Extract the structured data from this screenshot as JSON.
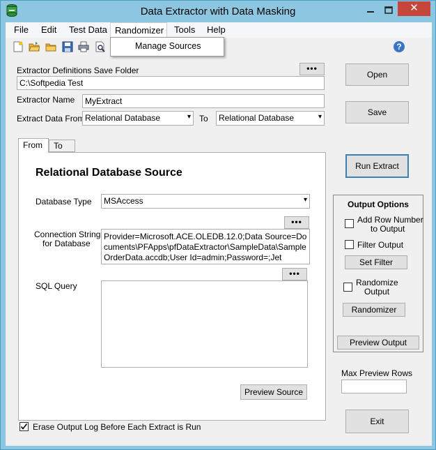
{
  "window": {
    "title": "Data Extractor with Data Masking",
    "close_glyph": "✕",
    "minimize_glyph": "–",
    "maximize_glyph": "☐"
  },
  "menu": {
    "items": [
      "File",
      "Edit",
      "Test Data",
      "Randomizer",
      "Tools",
      "Help"
    ],
    "active": "Randomizer",
    "dropdown": [
      "Manage Sources"
    ]
  },
  "toolbar": {
    "icons": [
      "new-file-icon",
      "open-folder-icon",
      "folder-icon",
      "save-icon",
      "print-icon",
      "print-preview-icon"
    ],
    "help": "?"
  },
  "definitions": {
    "folder_label": "Extractor Definitions Save Folder",
    "folder_value": "C:\\Softpedia Test",
    "browse_label": "•••",
    "name_label": "Extractor Name",
    "name_value": "MyExtract",
    "extract_from_label": "Extract Data From",
    "extract_from_value": "Relational Database",
    "to_label": "To",
    "to_value": "Relational Database"
  },
  "tabs": [
    {
      "label": "From",
      "selected": true
    },
    {
      "label": "To",
      "selected": false
    }
  ],
  "source": {
    "heading": "Relational Database Source",
    "db_type_label": "Database Type",
    "db_type_value": "MSAccess",
    "conn_label_line1": "Connection String",
    "conn_label_line2": "for Database",
    "conn_browse": "•••",
    "conn_value": "Provider=Microsoft.ACE.OLEDB.12.0;Data Source=Documents\\PFApps\\pfDataExtractor\\SampleData\\SampleOrderData.accdb;User Id=admin;Password=;Jet",
    "sql_label": "SQL Query",
    "sql_browse": "•••",
    "sql_value": "",
    "preview_button": "Preview Source"
  },
  "buttons": {
    "open": "Open",
    "save": "Save",
    "run_extract": "Run Extract",
    "exit": "Exit"
  },
  "output_options": {
    "title": "Output Options",
    "add_row_number_line1": "Add Row Number",
    "add_row_number_line2": "to Output",
    "filter_output": "Filter Output",
    "set_filter": "Set Filter",
    "randomize_line1": "Randomize",
    "randomize_line2": "Output",
    "randomizer": "Randomizer",
    "preview_output": "Preview Output"
  },
  "preview_rows": {
    "label": "Max Preview Rows",
    "value": ""
  },
  "footer": {
    "erase_log_label": "Erase Output Log Before Each Extract is Run",
    "erase_log_checked": true
  },
  "colors": {
    "title_bar": "#8dc6e0",
    "close_button": "#c7463c",
    "client_bg": "#f0f0f0"
  }
}
